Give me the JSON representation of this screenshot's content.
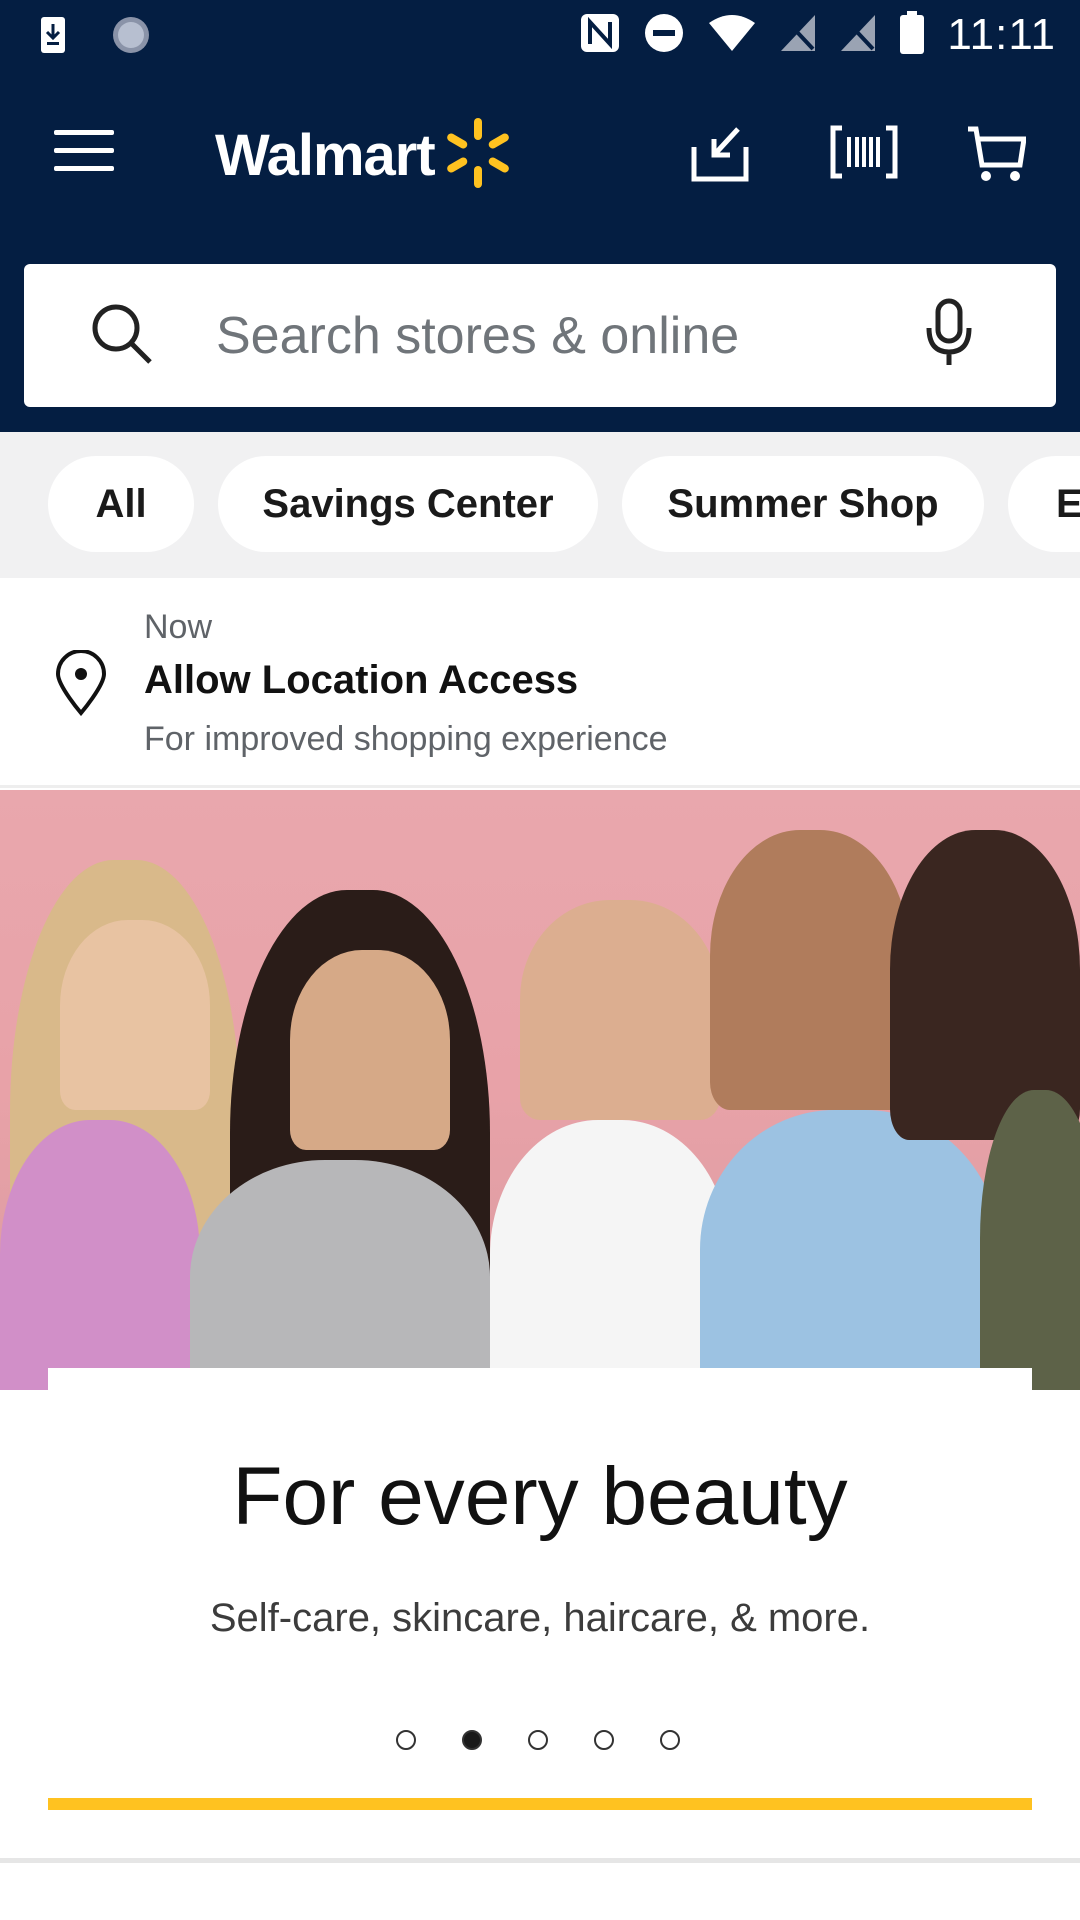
{
  "status_bar": {
    "time": "11:11"
  },
  "header": {
    "logo_text": "Walmart",
    "brand_colors": {
      "navy": "#041e42",
      "spark": "#ffc220"
    },
    "icons": [
      "menu-icon",
      "download-icon",
      "barcode-icon",
      "cart-icon"
    ]
  },
  "search": {
    "placeholder": "Search stores & online"
  },
  "chips": [
    "All",
    "Savings Center",
    "Summer Shop",
    "E"
  ],
  "location_banner": {
    "timestamp": "Now",
    "title": "Allow Location Access",
    "subtitle": "For improved shopping experience"
  },
  "hero": {
    "title": "For every beauty",
    "subtitle": "Self-care, skincare, haircare, & more.",
    "carousel_total": 5,
    "carousel_active_index": 1
  }
}
